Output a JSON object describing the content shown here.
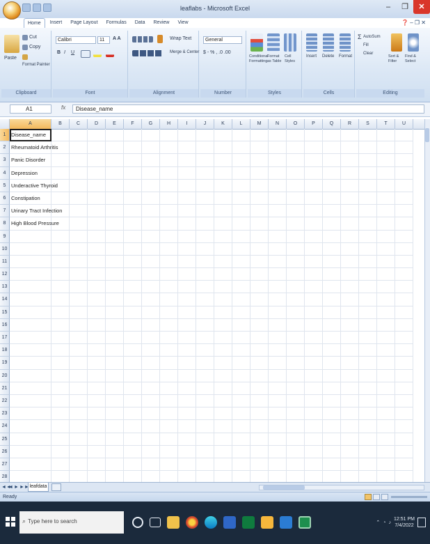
{
  "window": {
    "title": "leaflabs - Microsoft Excel",
    "controls": {
      "minimize": "–",
      "restore": "❐",
      "close": "✕"
    }
  },
  "tabs": [
    "Home",
    "Insert",
    "Page Layout",
    "Formulas",
    "Data",
    "Review",
    "View"
  ],
  "ribbon": {
    "groups": [
      "Clipboard",
      "Font",
      "Alignment",
      "Number",
      "Styles",
      "Cells",
      "Editing"
    ],
    "clipboard": {
      "paste": "Paste",
      "cut": "Cut",
      "copy": "Copy",
      "format_painter": "Format Painter"
    },
    "font": {
      "name": "Calibri",
      "size": "11",
      "bold": "B",
      "italic": "I",
      "underline": "U"
    },
    "alignment": {
      "wrap": "Wrap Text",
      "merge": "Merge & Center"
    },
    "number": {
      "format": "General",
      "buttons": "$ - % , .0 .00"
    },
    "styles": {
      "conditional": "Conditional Formatting",
      "format_table": "Format as Table",
      "cell_styles": "Cell Styles"
    },
    "cells": {
      "insert": "Insert",
      "delete": "Delete",
      "format": "Format"
    },
    "editing": {
      "autosum": "AutoSum",
      "fill": "Fill",
      "clear": "Clear",
      "sort": "Sort & Filter",
      "find": "Find & Select"
    }
  },
  "formula_bar": {
    "name_box": "A1",
    "fx": "fx",
    "content": "Disease_name"
  },
  "columns": [
    "A",
    "B",
    "C",
    "D",
    "E",
    "F",
    "G",
    "H",
    "I",
    "J",
    "K",
    "L",
    "M",
    "N",
    "O",
    "P",
    "Q",
    "R",
    "S",
    "T",
    "U"
  ],
  "rows": [
    "1",
    "2",
    "3",
    "4",
    "5",
    "6",
    "7",
    "8",
    "9",
    "10",
    "11",
    "12",
    "13",
    "14",
    "15",
    "16",
    "17",
    "18",
    "19",
    "20",
    "21",
    "22",
    "23",
    "24",
    "25",
    "26",
    "27",
    "28"
  ],
  "cells_col_a": [
    "Disease_name",
    "Rheumatoid Arthritis",
    "Panic Disorder",
    "Depression",
    "Underactive Thyroid",
    "Constipation",
    "Urinary Tract Infection",
    "High Blood Pressure"
  ],
  "sheet": {
    "tab": "leafdata",
    "nav": [
      "◄◄",
      "◄",
      "►",
      "►►"
    ]
  },
  "status": {
    "ready": "Ready"
  },
  "taskbar": {
    "search_placeholder": "Type here to search",
    "time": "12:51 PM",
    "date": "7/4/2022"
  }
}
